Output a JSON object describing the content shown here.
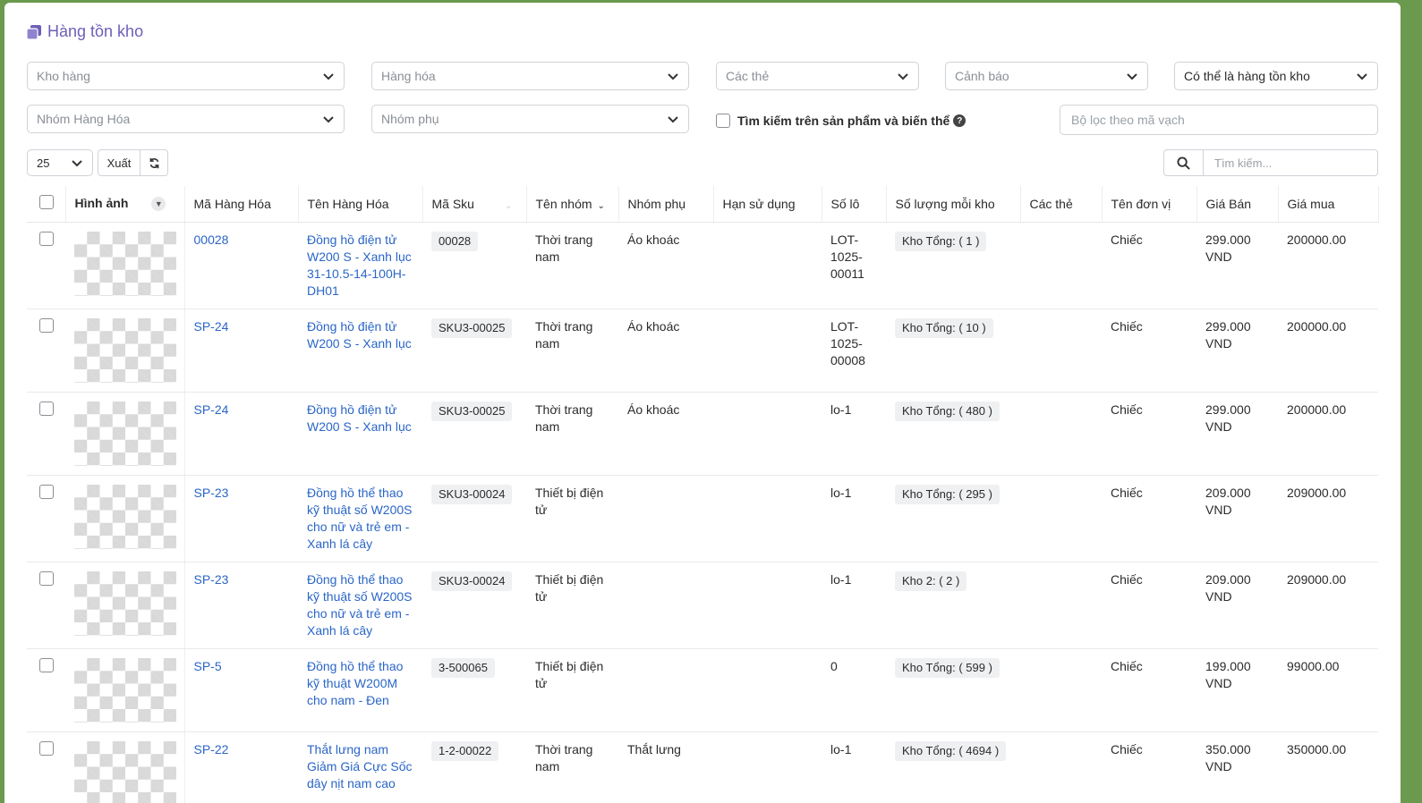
{
  "page": {
    "title": "Hàng tồn kho"
  },
  "filters": {
    "warehouse": "Kho hàng",
    "product": "Hàng hóa",
    "tags": "Các thẻ",
    "warning": "Cảnh báo",
    "stock_mode": "Có thể là hàng tồn kho",
    "product_group": "Nhóm Hàng Hóa",
    "sub_group": "Nhóm phụ",
    "search_variants_label": "Tìm kiếm trên sản phẩm và biến thể",
    "barcode_placeholder": "Bộ lọc theo mã vạch"
  },
  "toolbar": {
    "page_size": "25",
    "export_label": "Xuất",
    "search_placeholder": "Tìm kiếm..."
  },
  "table": {
    "columns": [
      "Hình ảnh",
      "Mã Hàng Hóa",
      "Tên Hàng Hóa",
      "Mã Sku",
      "Tên nhóm",
      "Nhóm phụ",
      "Hạn sử dụng",
      "Số lô",
      "Số lượng mỗi kho",
      "Các thẻ",
      "Tên đơn vị",
      "Giá Bán",
      "Giá mua"
    ],
    "rows": [
      {
        "code": "00028",
        "name": "Đồng hồ điện tử W200 S - Xanh lục 31-10.5-14-100H-DH01",
        "sku": "00028",
        "group": "Thời trang nam",
        "sub": "Áo khoác",
        "expiry": "",
        "lot": "LOT-1025-00011",
        "stock": "Kho Tổng: ( 1 )",
        "tags": "",
        "unit": "Chiếc",
        "sell": "299.000 VND",
        "buy": "200000.00"
      },
      {
        "code": "SP-24",
        "name": "Đồng hồ điện tử W200 S - Xanh lục",
        "sku": "SKU3-00025",
        "group": "Thời trang nam",
        "sub": "Áo khoác",
        "expiry": "",
        "lot": "LOT-1025-00008",
        "stock": "Kho Tổng: ( 10 )",
        "tags": "",
        "unit": "Chiếc",
        "sell": "299.000 VND",
        "buy": "200000.00"
      },
      {
        "code": "SP-24",
        "name": "Đồng hồ điện tử W200 S - Xanh lục",
        "sku": "SKU3-00025",
        "group": "Thời trang nam",
        "sub": "Áo khoác",
        "expiry": "",
        "lot": "lo-1",
        "stock": "Kho Tổng: ( 480 )",
        "tags": "",
        "unit": "Chiếc",
        "sell": "299.000 VND",
        "buy": "200000.00"
      },
      {
        "code": "SP-23",
        "name": "Đồng hồ thể thao kỹ thuật số W200S cho nữ và trẻ em - Xanh lá cây",
        "sku": "SKU3-00024",
        "group": "Thiết bị điện tử",
        "sub": "",
        "expiry": "",
        "lot": "lo-1",
        "stock": "Kho Tổng: ( 295 )",
        "tags": "",
        "unit": "Chiếc",
        "sell": "209.000 VND",
        "buy": "209000.00"
      },
      {
        "code": "SP-23",
        "name": "Đồng hồ thể thao kỹ thuật số W200S cho nữ và trẻ em - Xanh lá cây",
        "sku": "SKU3-00024",
        "group": "Thiết bị điện tử",
        "sub": "",
        "expiry": "",
        "lot": "lo-1",
        "stock": "Kho 2: ( 2 )",
        "tags": "",
        "unit": "Chiếc",
        "sell": "209.000 VND",
        "buy": "209000.00"
      },
      {
        "code": "SP-5",
        "name": "Đồng hồ thể thao kỹ thuật W200M cho nam - Đen",
        "sku": "3-500065",
        "group": "Thiết bị điện tử",
        "sub": "",
        "expiry": "",
        "lot": "0",
        "stock": "Kho Tổng: ( 599 )",
        "tags": "",
        "unit": "Chiếc",
        "sell": "199.000 VND",
        "buy": "99000.00"
      },
      {
        "code": "SP-22",
        "name": "Thắt lưng nam Giảm Giá Cực Sốc dây nịt nam cao",
        "sku": "1-2-00022",
        "group": "Thời trang nam",
        "sub": "Thắt lưng",
        "expiry": "",
        "lot": "lo-1",
        "stock": "Kho Tổng: ( 4694 )",
        "tags": "",
        "unit": "Chiếc",
        "sell": "350.000 VND",
        "buy": "350000.00"
      }
    ]
  },
  "colors": {
    "accent": "#6d5fb8",
    "link": "#2a66c7",
    "frame": "#6b9a4f"
  }
}
